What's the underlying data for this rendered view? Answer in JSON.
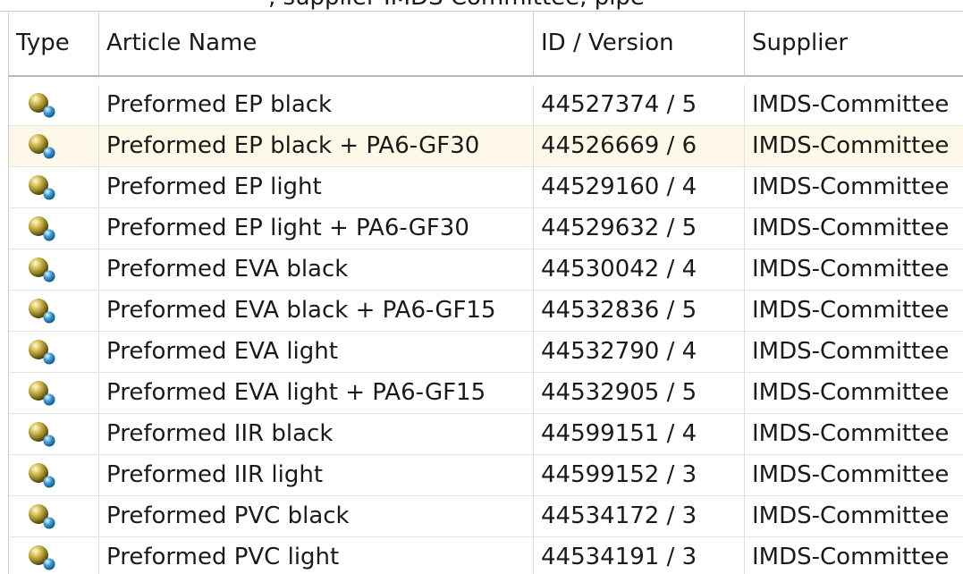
{
  "top_strip": {
    "clipped_text": ", supplier IMDS Committee, pipe"
  },
  "table": {
    "columns": {
      "type": "Type",
      "article_name": "Article Name",
      "id_version": "ID / Version",
      "supplier": "Supplier"
    },
    "rows": [
      {
        "icon": "material-sphere-icon",
        "name": "Preformed EP black",
        "id_version": "44527374 / 5",
        "supplier": "IMDS-Committee"
      },
      {
        "icon": "material-sphere-icon",
        "name": "Preformed EP black + PA6-GF30",
        "id_version": "44526669 / 6",
        "supplier": "IMDS-Committee",
        "highlighted": true
      },
      {
        "icon": "material-sphere-icon",
        "name": "Preformed EP light",
        "id_version": "44529160 / 4",
        "supplier": "IMDS-Committee"
      },
      {
        "icon": "material-sphere-icon",
        "name": "Preformed EP light + PA6-GF30",
        "id_version": "44529632 / 5",
        "supplier": "IMDS-Committee"
      },
      {
        "icon": "material-sphere-icon",
        "name": "Preformed EVA black",
        "id_version": "44530042 / 4",
        "supplier": "IMDS-Committee"
      },
      {
        "icon": "material-sphere-icon",
        "name": "Preformed EVA black + PA6-GF15",
        "id_version": "44532836 / 5",
        "supplier": "IMDS-Committee"
      },
      {
        "icon": "material-sphere-icon",
        "name": "Preformed EVA light",
        "id_version": "44532790 / 4",
        "supplier": "IMDS-Committee"
      },
      {
        "icon": "material-sphere-icon",
        "name": "Preformed EVA light + PA6-GF15",
        "id_version": "44532905 / 5",
        "supplier": "IMDS-Committee"
      },
      {
        "icon": "material-sphere-icon",
        "name": "Preformed IIR black",
        "id_version": "44599151 / 4",
        "supplier": "IMDS-Committee"
      },
      {
        "icon": "material-sphere-icon",
        "name": "Preformed IIR light",
        "id_version": "44599152 / 3",
        "supplier": "IMDS-Committee"
      },
      {
        "icon": "material-sphere-icon",
        "name": "Preformed PVC black",
        "id_version": "44534172 / 3",
        "supplier": "IMDS-Committee"
      },
      {
        "icon": "material-sphere-icon",
        "name": "Preformed PVC light",
        "id_version": "44534191 / 3",
        "supplier": "IMDS-Committee"
      }
    ]
  },
  "colors": {
    "highlight_row": "#fdf8e8",
    "grid_line": "#e0e0e0"
  }
}
